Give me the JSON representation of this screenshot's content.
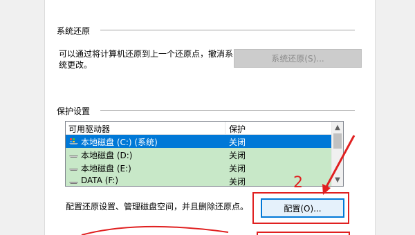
{
  "system_restore": {
    "title": "系统还原",
    "description_line1": "可以通过将计算机还原到上一个还原点，撤消系",
    "description_line2": "统更改。",
    "button_label": "系统还原(S)..."
  },
  "protection": {
    "title": "保护设置",
    "columns": [
      "可用驱动器",
      "保护"
    ],
    "drives": [
      {
        "name": "本地磁盘 (C:) (系统)",
        "status": "关闭",
        "icon": "system-drive-icon",
        "selected": true
      },
      {
        "name": "本地磁盘 (D:)",
        "status": "关闭",
        "icon": "drive-icon",
        "selected": false
      },
      {
        "name": "本地磁盘 (E:)",
        "status": "关闭",
        "icon": "drive-icon",
        "selected": false
      },
      {
        "name": "DATA (F:)",
        "status": "关闭",
        "icon": "drive-icon",
        "selected": false
      }
    ],
    "configure_description": "配置还原设置、管理磁盘空间，并且删除还原点。",
    "configure_button_label": "配置(O)..."
  },
  "annotation": {
    "step_number": "2",
    "color": "#e02020"
  },
  "colors": {
    "selected_row": "#0078d7",
    "list_row": "#c8e8c8"
  }
}
